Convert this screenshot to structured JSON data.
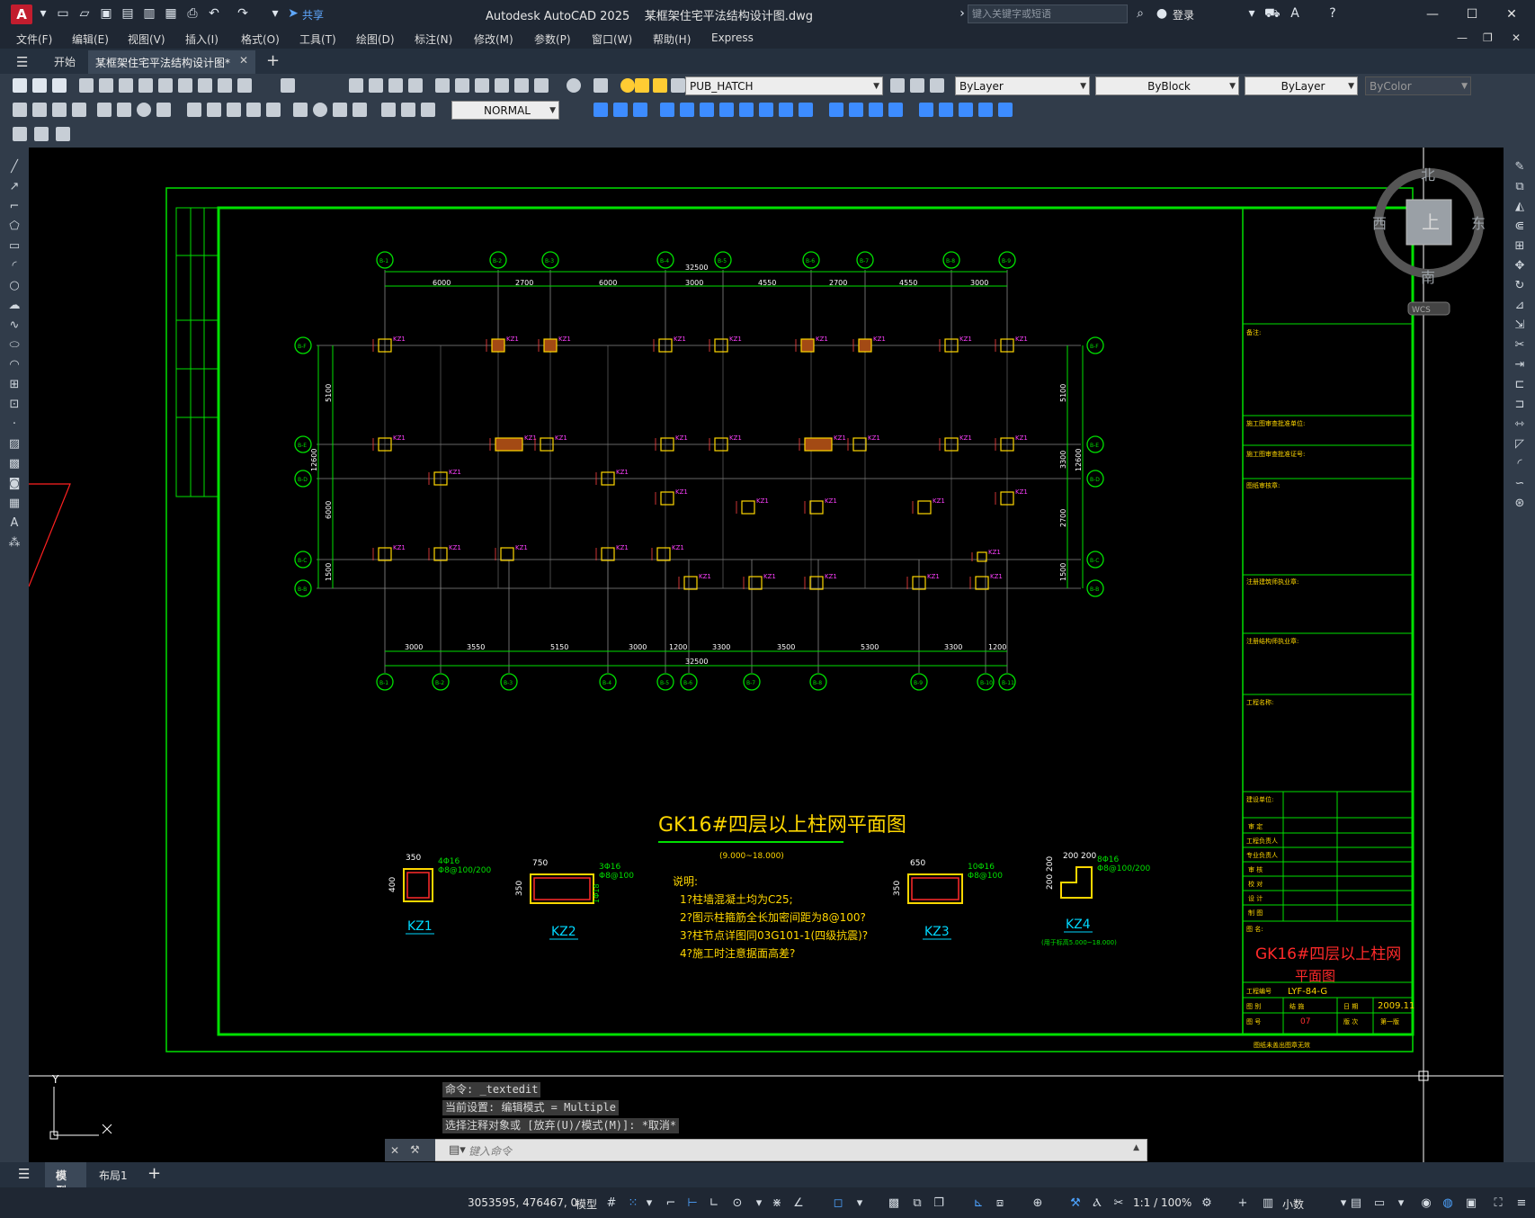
{
  "titlebar": {
    "app_title": "Autodesk AutoCAD 2025    某框架住宅平法结构设计图.dwg",
    "search_placeholder": "键入关键字或短语",
    "share_label": "共享",
    "signin_label": "登录",
    "minimize_icon": "minimize-icon",
    "maximize_icon": "maximize-icon",
    "close_icon": "close-icon"
  },
  "menus": [
    "文件(F)",
    "编辑(E)",
    "视图(V)",
    "插入(I)",
    "格式(O)",
    "工具(T)",
    "绘图(D)",
    "标注(N)",
    "修改(M)",
    "参数(P)",
    "窗口(W)",
    "帮助(H)",
    "Express"
  ],
  "tabs": {
    "start": "开始",
    "document": "某框架住宅平法结构设计图*"
  },
  "toolbar": {
    "layer": "PUB_HATCH",
    "color": "ByLayer",
    "linetype": "ByBlock",
    "lineweight": "ByLayer",
    "plotstyle": "ByColor",
    "dimstyle": "NORMAL"
  },
  "viewcube": {
    "north": "北",
    "south": "南",
    "east": "东",
    "west": "西",
    "top": "上",
    "wcs": "WCS"
  },
  "plan": {
    "top_axes": [
      "B-1",
      "B-2",
      "B-3",
      "B-4",
      "B-5",
      "B-6",
      "B-7",
      "B-8",
      "B-9"
    ],
    "bottom_axes": [
      "B-1",
      "B-2",
      "B-3",
      "B-4",
      "B-5",
      "B-6",
      "B-7",
      "B-8",
      "B-9",
      "B-10",
      "B-11"
    ],
    "left_axes": [
      "B-F",
      "B-E",
      "B-D",
      "B-C",
      "B-B"
    ],
    "right_axes": [
      "B-F",
      "B-E",
      "B-D",
      "B-C",
      "B-B"
    ],
    "top_total": "32500",
    "top_dims": [
      "6000",
      "2700",
      "6000",
      "3000",
      "4550",
      "2700",
      "4550",
      "3000"
    ],
    "bottom_total": "32500",
    "bottom_dims": [
      "3000",
      "3550",
      "5150",
      "3000",
      "1200",
      "3300",
      "3500",
      "5300",
      "3300",
      "1200"
    ],
    "left_total": "12600",
    "left_dims": [
      "5100",
      "6000",
      "1500"
    ],
    "right_total": "12600",
    "right_dims": [
      "5100",
      "3300",
      "2700",
      "1500"
    ],
    "title": "GK16#四层以上柱网平面图",
    "elevation": "(9.000~18.000)",
    "notes_title": "说明:",
    "notes": [
      "1?柱墙混凝土均为C25;",
      "2?图示柱箍筋全长加密间距为8@100?",
      "3?柱节点详图同03G101-1(四级抗震)?",
      "4?施工时注意据面高差?"
    ]
  },
  "details": [
    {
      "name": "KZ1",
      "w": "350",
      "h": "400",
      "rebar1": "4Φ16",
      "rebar2": "Φ8@100/200"
    },
    {
      "name": "KZ2",
      "w": "750",
      "h": "350",
      "rebar1": "3Φ16",
      "rebar2": "Φ8@100",
      "extra": "1Φ18"
    },
    {
      "name": "KZ3",
      "w": "650",
      "h": "350",
      "rebar1": "10Φ16",
      "rebar2": "Φ8@100"
    },
    {
      "name": "KZ4",
      "w": "200 200",
      "h": "200 200",
      "rebar1": "8Φ16",
      "rebar2": "Φ8@100/200",
      "note": "(用于标高5.000~18.000)"
    }
  ],
  "titleblock": {
    "remarks": "备注:",
    "rows": [
      "施工图审查批准单位:",
      "施工图审查批准证号:",
      "图纸审核章:",
      "注册建筑师执业章:",
      "注册结构师执业章:",
      "工程名称:",
      "建设单位:"
    ],
    "sign_rows": [
      "审 定",
      "工程负责人",
      "专业负责人",
      "审 核",
      "校 对",
      "设 计",
      "制 图"
    ],
    "drawing_name_label": "图 名:",
    "drawing_name_line1": "GK16#四层以上柱网",
    "drawing_name_line2": "平面图",
    "project_no_label": "工程编号",
    "project_no": "LYF-84-G",
    "category_label": "图 别",
    "category": "结 施",
    "date_label": "日 期",
    "date": "2009.11",
    "sheet_label": "图 号",
    "sheet": "07",
    "version_label": "版 次",
    "version": "第一版",
    "footer": "图纸未盖出图章无效"
  },
  "command": {
    "history": [
      "命令: _textedit",
      "当前设置: 编辑模式 = Multiple",
      "选择注释对象或 [放弃(U)/模式(M)]: *取消*"
    ],
    "placeholder": "键入命令"
  },
  "layout_tabs": {
    "model": "模型",
    "layout1": "布局1"
  },
  "statusbar": {
    "coords": "3053595, 476467, 0",
    "model_label": "模型",
    "scale": "1:1 / 100%",
    "units": "小数"
  },
  "colors": {
    "frame_green": "#00e000",
    "column_yellow": "#ffd700",
    "label_magenta": "#ff40ff",
    "title_red": "#ff2a2a",
    "ui_dark": "#1f2733"
  }
}
